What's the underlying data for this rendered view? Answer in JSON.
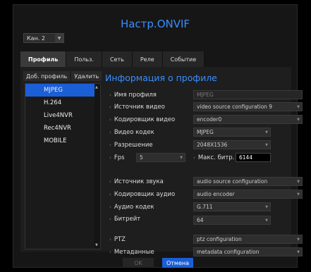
{
  "title": "Настр.ONVIF",
  "channel": "Кан. 2",
  "tabs": [
    "Профиль",
    "Польз.",
    "Сеть",
    "Реле",
    "Событие"
  ],
  "sub_buttons": {
    "add": "Доб. профиль",
    "delete": "Удалить"
  },
  "profiles": [
    "MJPEG",
    "H.264",
    "Live4NVR",
    "Rec4NVR",
    "MOBILE"
  ],
  "selected_profile": "MJPEG",
  "panel_title": "Информация о профиле",
  "labels": {
    "profile_name": "Имя профиля",
    "video_source": "Источник видео",
    "video_encoder": "Кодировщик видео",
    "video_codec": "Видео кодек",
    "resolution": "Разрешение",
    "fps": "Fps",
    "max_bitrate": "Макс. битр.",
    "audio_source": "Источник звука",
    "audio_encoder": "Кодировщик аудио",
    "audio_codec": "Аудио кодек",
    "bitrate": "Битрейт",
    "ptz": "PTZ",
    "metadata": "Метаданные"
  },
  "values": {
    "profile_name": "MJPEG",
    "video_source": "video source configuration 9",
    "video_encoder": "encoder0",
    "video_codec": "MJPEG",
    "resolution": "2048X1536",
    "fps": "5",
    "max_bitrate": "6144",
    "audio_source": "audio source configuration",
    "audio_encoder": "audio encoder",
    "audio_codec": "G.711",
    "bitrate": "64",
    "ptz": "ptz configuration",
    "metadata": "metadata configuration"
  },
  "buttons": {
    "ok": "OK",
    "cancel": "Отмена"
  }
}
